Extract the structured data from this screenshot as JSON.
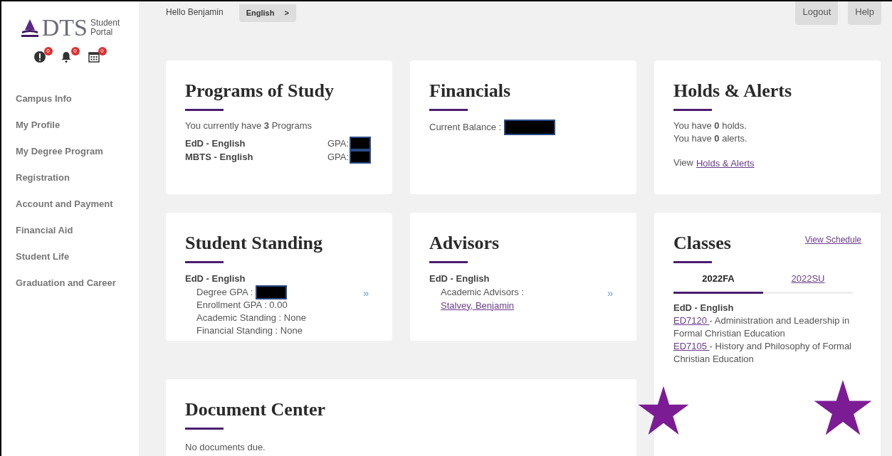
{
  "sidebar": {
    "logo": {
      "mark": "DTS",
      "line_1": "Student",
      "line_2": "Portal"
    },
    "badges": [
      {
        "kind": "alert",
        "count": "0"
      },
      {
        "kind": "bell",
        "count": "0"
      },
      {
        "kind": "calendar",
        "count": "0"
      }
    ],
    "items": [
      {
        "label": "Campus Info"
      },
      {
        "label": "My Profile"
      },
      {
        "label": "My Degree Program"
      },
      {
        "label": "Registration"
      },
      {
        "label": "Account and Payment"
      },
      {
        "label": "Financial Aid"
      },
      {
        "label": "Student Life"
      },
      {
        "label": "Graduation and Career"
      }
    ]
  },
  "header": {
    "greeting": "Hello Benjamin",
    "language": "English",
    "language_arrow": ">",
    "buttons": [
      "Logout",
      "Help"
    ]
  },
  "programs": {
    "title": "Programs of Study",
    "summary": "You currently have **3** Programs",
    "rows": [
      {
        "name": "EdD - English",
        "gpa_label": "GPA:",
        "redacted": true
      },
      {
        "name": "MBTS - English",
        "gpa_label": "GPA:",
        "redacted": true
      }
    ]
  },
  "financials": {
    "title": "Financials",
    "balance_label": "Current Balance :",
    "redacted": true
  },
  "holds": {
    "title": "Holds & Alerts",
    "lines": [
      "You have **0** holds.",
      "You have **0** alerts."
    ],
    "view_label": "View",
    "view_link": "Holds & Alerts"
  },
  "standing": {
    "title": "Student Standing",
    "program": "EdD - English",
    "lines": [
      {
        "text": "Degree GPA :",
        "redacted": true
      },
      {
        "text": "Enrollment GPA : 0.00",
        "redacted": false
      },
      {
        "text": "Academic Standing : None",
        "redacted": false
      },
      {
        "text": "Financial Standing : None",
        "redacted": false
      }
    ],
    "more": "»"
  },
  "advisors": {
    "title": "Advisors",
    "program": "EdD - English",
    "label": "Academic Advisors :",
    "link": "Stalvey, Benjamin",
    "more": "»"
  },
  "classes": {
    "title": "Classes",
    "schedule_link": "View Schedule",
    "tabs": [
      {
        "label": "2022FA",
        "selected": true
      },
      {
        "label": "2022SU",
        "selected": false
      }
    ],
    "program": "EdD - English",
    "courses": [
      {
        "code": "ED7120 ",
        "title": "- Administration and Leadership in Formal Christian Education"
      },
      {
        "code": "ED7105 ",
        "title": "- History and Philosophy of Formal Christian Education"
      }
    ]
  },
  "documents": {
    "title": "Document Center",
    "message": "No documents due."
  }
}
